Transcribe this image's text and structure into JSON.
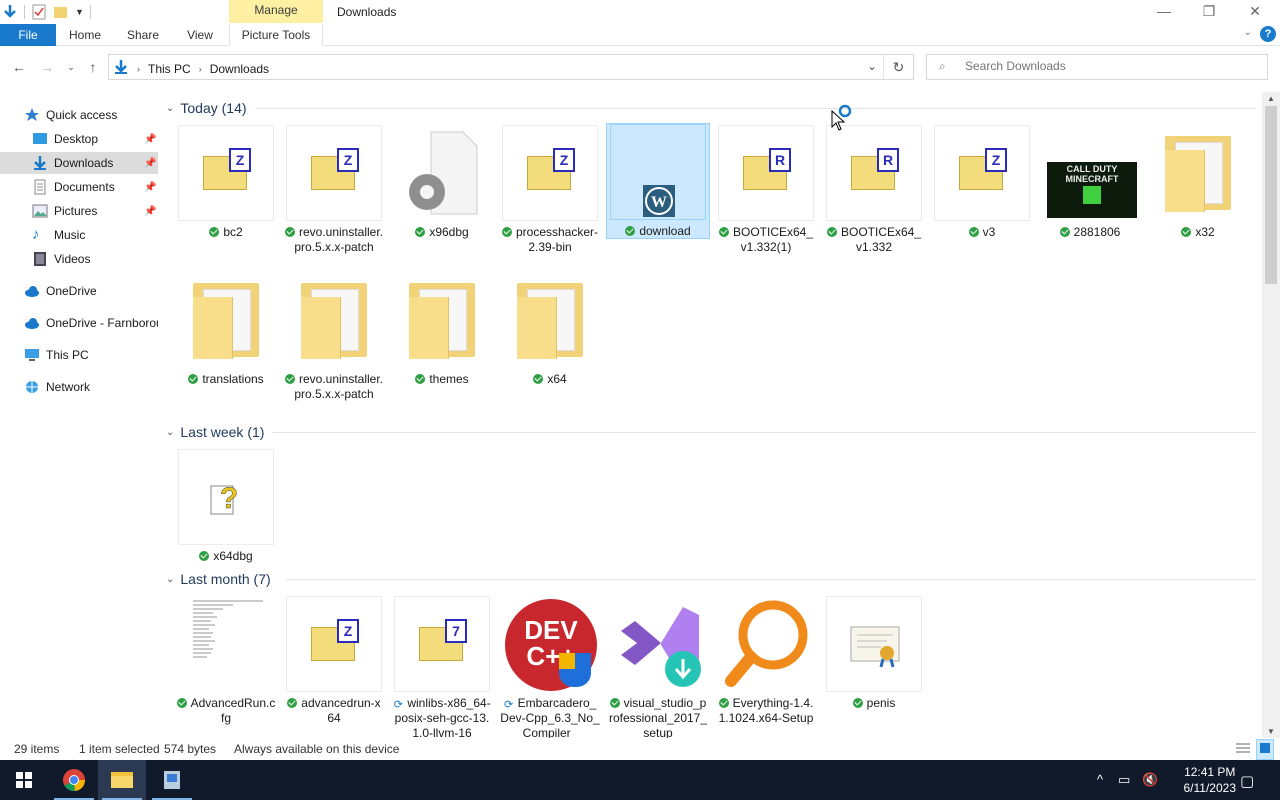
{
  "window": {
    "title": "Downloads",
    "manage_label": "Manage"
  },
  "ribbon": {
    "tabs": [
      "File",
      "Home",
      "Share",
      "View",
      "Picture Tools"
    ],
    "help": "?"
  },
  "address": {
    "crumbs": [
      "This PC",
      "Downloads"
    ]
  },
  "search": {
    "placeholder": "Search Downloads"
  },
  "sidebar": {
    "items": [
      {
        "label": "Quick access",
        "icon": "star-icon"
      },
      {
        "label": "Desktop",
        "icon": "desktop-icon",
        "pinned": true
      },
      {
        "label": "Downloads",
        "icon": "download-icon",
        "pinned": true,
        "selected": true
      },
      {
        "label": "Documents",
        "icon": "documents-icon",
        "pinned": true
      },
      {
        "label": "Pictures",
        "icon": "pictures-icon",
        "pinned": true
      },
      {
        "label": "Music",
        "icon": "music-icon"
      },
      {
        "label": "Videos",
        "icon": "videos-icon"
      },
      {
        "label": "OneDrive",
        "icon": "cloud-icon"
      },
      {
        "label": "OneDrive - Farnborou",
        "icon": "cloud-icon"
      },
      {
        "label": "This PC",
        "icon": "pc-icon"
      },
      {
        "label": "Network",
        "icon": "network-icon"
      }
    ]
  },
  "groups": [
    {
      "title": "Today (14)",
      "items": [
        {
          "name": "bc2",
          "type": "archive",
          "badge": "Z"
        },
        {
          "name": "revo.uninstaller.pro.5.x.x-patch",
          "type": "archive",
          "badge": "Z"
        },
        {
          "name": "x96dbg",
          "type": "exe"
        },
        {
          "name": "processhacker-2.39-bin",
          "type": "archive",
          "badge": "Z"
        },
        {
          "name": "download",
          "type": "wordpress",
          "selected": true
        },
        {
          "name": "BOOTICEx64_v1.332(1)",
          "type": "archive",
          "badge": "R"
        },
        {
          "name": "BOOTICEx64_v1.332",
          "type": "archive",
          "badge": "R"
        },
        {
          "name": "v3",
          "type": "archive",
          "badge": "Z"
        },
        {
          "name": "2881806",
          "type": "image",
          "image_text": "CALL DUTY MINECRAFT"
        },
        {
          "name": "x32",
          "type": "folder"
        },
        {
          "name": "translations",
          "type": "folder"
        },
        {
          "name": "revo.uninstaller.pro.5.x.x-patch",
          "type": "folder"
        },
        {
          "name": "themes",
          "type": "folder"
        },
        {
          "name": "x64",
          "type": "folder"
        }
      ]
    },
    {
      "title": "Last week (1)",
      "items": [
        {
          "name": "x64dbg",
          "type": "unknown"
        }
      ]
    },
    {
      "title": "Last month (7)",
      "items": [
        {
          "name": "AdvancedRun.cfg",
          "type": "text"
        },
        {
          "name": "advancedrun-x64",
          "type": "archive",
          "badge": "Z"
        },
        {
          "name": "winlibs-x86_64-posix-seh-gcc-13.1.0-llvm-16",
          "type": "archive",
          "badge": "7",
          "syncing": true
        },
        {
          "name": "Embarcadero_Dev-Cpp_6.3_No_Compiler_",
          "type": "devcpp",
          "syncing": true,
          "image_text": "DEV C++"
        },
        {
          "name": "visual_studio_professional_2017_setup",
          "type": "vs"
        },
        {
          "name": "Everything-1.4.1.1024.x64-Setup",
          "type": "everything"
        },
        {
          "name": "penis",
          "type": "cert"
        }
      ]
    }
  ],
  "status": {
    "count": "29 items",
    "selection": "1 item selected",
    "size": "574 bytes",
    "availability": "Always available on this device"
  },
  "taskbar": {
    "time": "12:41 PM",
    "date": "6/11/2023"
  }
}
